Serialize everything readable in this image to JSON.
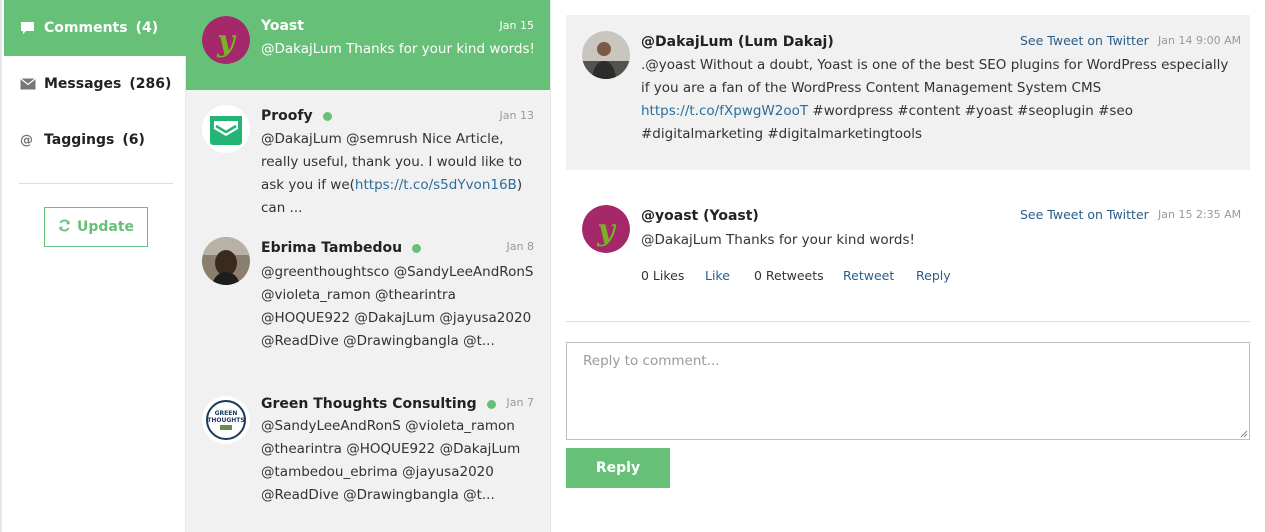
{
  "colors": {
    "accent": "#67c077",
    "link": "#2a5d8a",
    "panel": "#f1f1f1"
  },
  "sidebar": {
    "items": [
      {
        "icon": "comment-icon",
        "label": "Comments",
        "count": "(4)",
        "active": true
      },
      {
        "icon": "envelope-icon",
        "label": "Messages",
        "count": "(286)",
        "active": false
      },
      {
        "icon": "at-icon",
        "label": "Taggings",
        "count": "(6)",
        "active": false
      }
    ],
    "update_label": "Update"
  },
  "conversations": [
    {
      "name": "Yoast",
      "date": "Jan 15",
      "online": false,
      "text": "@DakajLum Thanks for your kind words!"
    },
    {
      "name": "Proofy",
      "date": "Jan 13",
      "online": true,
      "text_before": "@DakajLum @semrush Nice Article, really useful, thank you. I would like to ask you if we(",
      "link": "https://t.co/s5dYvon16B",
      "text_after": ") can ..."
    },
    {
      "name": "Ebrima Tambedou",
      "date": "Jan 8",
      "online": true,
      "text": "@greenthoughtsco @SandyLeeAndRonS @violeta_ramon @thearintra @HOQUE922 @DakajLum @jayusa2020 @ReadDive @Drawingbangla @t..."
    },
    {
      "name": "Green Thoughts Consulting",
      "date": "Jan 7",
      "online": true,
      "avatar_text": "GREEN THOUGHTS",
      "text": "@SandyLeeAndRonS @violeta_ramon @thearintra @HOQUE922 @DakajLum @tambedou_ebrima @jayusa2020 @ReadDive @Drawingbangla @t..."
    }
  ],
  "thread": {
    "original": {
      "author": "@DakajLum (Lum Dakaj)",
      "see_link": "See Tweet on Twitter",
      "date": "Jan 14 9:00 AM",
      "text": ".@yoast Without a doubt, Yoast is one of the best SEO plugins for WordPress especially if you are a fan of the WordPress Content Management System CMS",
      "link": "https://t.co/fXpwgW2ooT",
      "hashtags": "#wordpress #content #yoast #seoplugin #seo #digitalmarketing #digitalmarketingtools"
    },
    "reply": {
      "author": "@yoast (Yoast)",
      "see_link": "See Tweet on Twitter",
      "date": "Jan 15 2:35 AM",
      "text": "@DakajLum Thanks for your kind words!",
      "likes": "0 Likes",
      "like_label": "Like",
      "retweets": "0 Retweets",
      "retweet_label": "Retweet",
      "reply_label": "Reply"
    },
    "reply_placeholder": "Reply to comment...",
    "reply_button": "Reply"
  }
}
